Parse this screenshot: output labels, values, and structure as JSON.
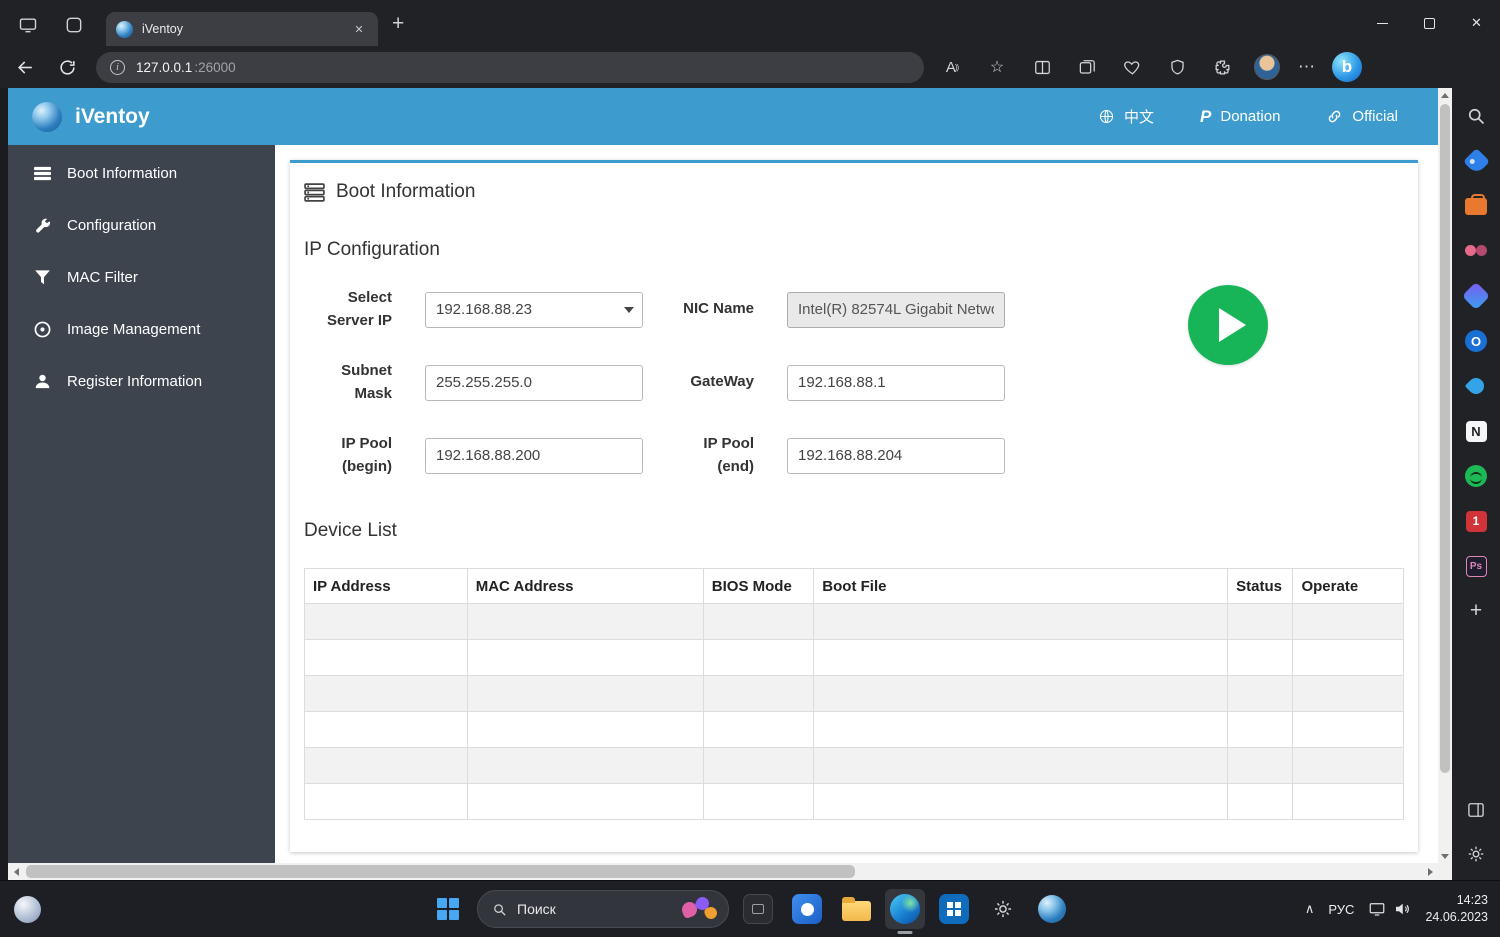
{
  "theme": {
    "header_blue": "#3e9bce",
    "sidebar_dark": "#3d444e",
    "play_green": "#17b558",
    "chrome_dark": "#212226"
  },
  "browser": {
    "tab_title": "iVentoy",
    "url": {
      "host": "127.0.0.1",
      "port": ":26000"
    }
  },
  "app": {
    "brand": "iVentoy",
    "header_links": {
      "language": "中文",
      "donation": "Donation",
      "official": "Official"
    },
    "nav_items": [
      "Boot Information",
      "Configuration",
      "MAC Filter",
      "Image Management",
      "Register Information"
    ],
    "page": {
      "heading": "Boot Information",
      "ip_section": {
        "title": "IP Configuration",
        "select_server_ip_label": "Select Server IP",
        "select_server_ip_value": "192.168.88.23",
        "nic_name_label": "NIC Name",
        "nic_name_value": "Intel(R) 82574L Gigabit Netwo",
        "subnet_mask_label": "Subnet Mask",
        "subnet_mask_value": "255.255.255.0",
        "gateway_label": "GateWay",
        "gateway_value": "192.168.88.1",
        "ip_pool_begin_label": "IP Pool (begin)",
        "ip_pool_begin_value": "192.168.88.200",
        "ip_pool_end_label": "IP Pool (end)",
        "ip_pool_end_value": "192.168.88.204"
      },
      "device_list": {
        "title": "Device List",
        "columns": [
          "IP Address",
          "MAC Address",
          "BIOS Mode",
          "Boot File",
          "Status",
          "Operate"
        ],
        "empty_row_count": 6
      }
    }
  },
  "taskbar": {
    "search_label": "Поиск",
    "language": "РУС",
    "time": "14:23",
    "date": "24.06.2023"
  }
}
